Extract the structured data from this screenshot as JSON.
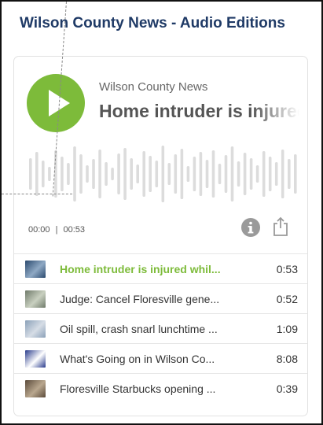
{
  "page": {
    "title": "Wilson County News - Audio Editions"
  },
  "player": {
    "source": "Wilson County News",
    "headline": "Home intruder is injured while",
    "time_current": "00:00",
    "time_separator": "|",
    "time_total": "00:53",
    "accent_color": "#7dbb3a"
  },
  "icons": {
    "play": "play-icon",
    "info": "info-icon",
    "share": "share-icon"
  },
  "playlist": [
    {
      "title": "Home intruder is injured whil...",
      "duration": "0:53",
      "active": true
    },
    {
      "title": "Judge: Cancel Floresville gene...",
      "duration": "0:52",
      "active": false
    },
    {
      "title": "Oil spill, crash snarl lunchtime ...",
      "duration": "1:09",
      "active": false
    },
    {
      "title": "What's Going on in Wilson Co...",
      "duration": "8:08",
      "active": false
    },
    {
      "title": "Floresville Starbucks opening ...",
      "duration": "0:39",
      "active": false
    }
  ]
}
